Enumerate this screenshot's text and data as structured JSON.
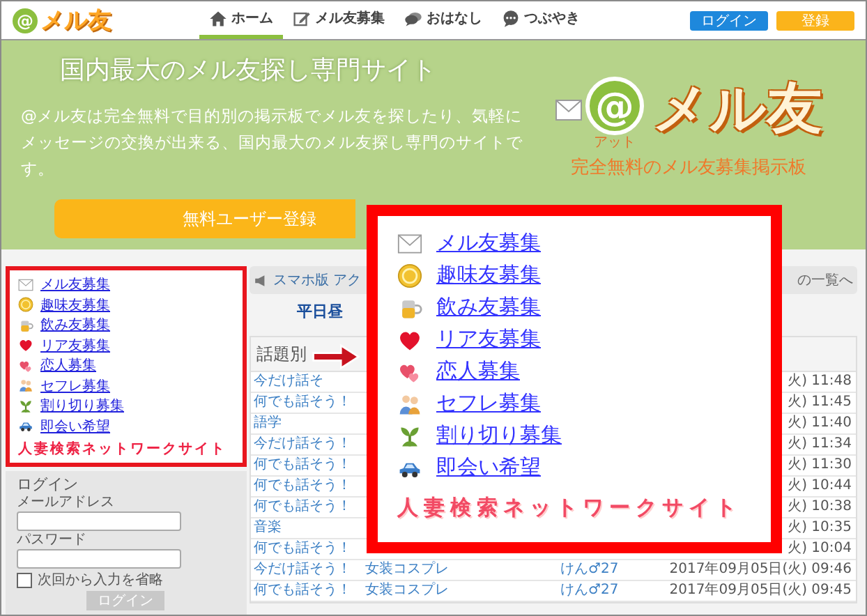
{
  "header": {
    "logo": {
      "mark": "@",
      "name": "メル友"
    },
    "nav": [
      {
        "label": "ホーム",
        "selected": true
      },
      {
        "label": "メル友募集",
        "selected": false
      },
      {
        "label": "おはなし",
        "selected": false
      },
      {
        "label": "つぶやき",
        "selected": false
      }
    ],
    "buttons": [
      {
        "label": "ログイン",
        "kind": "login"
      },
      {
        "label": "登録",
        "kind": "register"
      }
    ]
  },
  "hero": {
    "title": "国内最大のメル友探し専門サイト",
    "description": "@メル友は完全無料で目的別の掲示板でメル友を探したり、気軽にメッセージの交換が出来る、国内最大のメル友探し専門のサイトです。",
    "logo": {
      "mark": "@",
      "name": "メル友",
      "reading": "アット",
      "tagline": "完全無料のメル友募集掲示板"
    },
    "cta": "無料ユーザー登録"
  },
  "sidebar": {
    "categories": [
      "メル友募集",
      "趣味友募集",
      "飲み友募集",
      "リア友募集",
      "恋人募集",
      "セフレ募集",
      "割り切り募集",
      "即会い希望"
    ],
    "caption": "人妻検索ネットワークサイト",
    "login": {
      "title": "ログイン",
      "fields": [
        {
          "label": "メールアドレス"
        },
        {
          "label": "パスワード"
        }
      ],
      "remember": {
        "label": "次回から入力を省略",
        "checked": false
      },
      "submit": "ログイン"
    }
  },
  "board": {
    "toolbar": {
      "items": [
        "スマホ版",
        "アク"
      ],
      "link": "の一覧へ"
    },
    "subtitle": "平日昼",
    "card_title": "話題別",
    "rows": [
      {
        "topic": "今だけ話そ",
        "date": "火) 11:48"
      },
      {
        "topic": "何でも話そう！",
        "date": "火) 11:45"
      },
      {
        "topic": "語学",
        "date": "火) 11:40"
      },
      {
        "topic": "今だけ話そう！",
        "date": "火) 11:34"
      },
      {
        "topic": "何でも話そう！",
        "date": "火) 11:30"
      },
      {
        "topic": "何でも話そう！",
        "date": "火) 10:44"
      },
      {
        "topic": "何でも話そう！",
        "date": "火) 10:38"
      },
      {
        "topic": "音楽",
        "date": "火) 10:35"
      },
      {
        "topic": "何でも話そう！",
        "date": "火) 10:04"
      },
      {
        "topic": "今だけ話そう！",
        "title": "女装コスプレ",
        "user": "けん♂27",
        "date": "2017年09月05日(火) 09:46"
      },
      {
        "topic": "何でも話そう！",
        "title": "女装コスプレ",
        "user": "けん♂27",
        "date": "2017年09月05日(火) 09:45"
      }
    ]
  },
  "callout": {
    "categories": [
      "メル友募集",
      "趣味友募集",
      "飲み友募集",
      "リア友募集",
      "恋人募集",
      "セフレ募集",
      "割り切り募集",
      "即会い希望"
    ],
    "caption": "人妻検索ネットワークサイト"
  }
}
